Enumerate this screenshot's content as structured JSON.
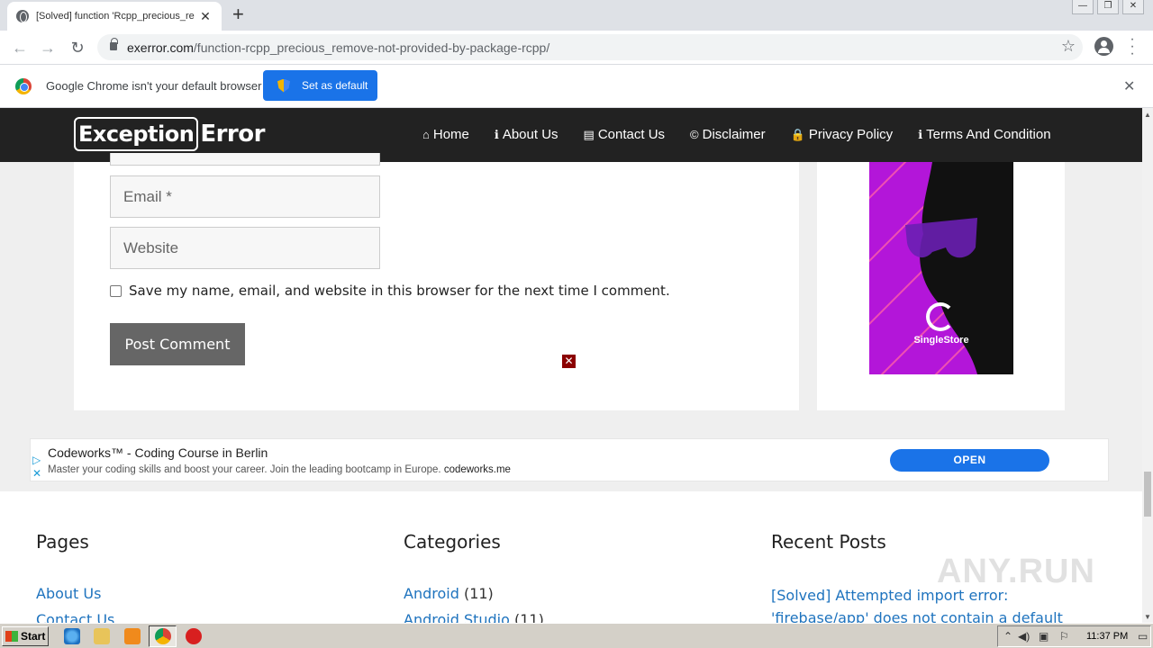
{
  "browser": {
    "tab_title": "[Solved] function 'Rcpp_precious_re",
    "tab_close": "✕",
    "new_tab": "+",
    "url_host": "exerror.com",
    "url_path": "/function-rcpp_precious_remove-not-provided-by-package-rcpp/",
    "window_controls": [
      "—",
      "❐",
      "✕"
    ]
  },
  "infobar": {
    "message": "Google Chrome isn't your default browser",
    "button": "Set as default",
    "close": "✕"
  },
  "site": {
    "logo_boxed": "Exception",
    "logo_rest": "Error",
    "nav": [
      {
        "icon": "home-icon",
        "glyph": "⌂",
        "label": "Home"
      },
      {
        "icon": "info-icon",
        "glyph": "ℹ",
        "label": "About Us"
      },
      {
        "icon": "contact-card-icon",
        "glyph": "▤",
        "label": "Contact Us"
      },
      {
        "icon": "copyright-icon",
        "glyph": "©",
        "label": "Disclaimer"
      },
      {
        "icon": "lock-icon",
        "glyph": "🔒",
        "label": "Privacy Policy"
      },
      {
        "icon": "info-circle-icon",
        "glyph": "ℹ",
        "label": "Terms And Condition"
      }
    ]
  },
  "form": {
    "email_placeholder": "Email *",
    "website_placeholder": "Website",
    "save_info_label": "Save my name, email, and website in this browser for the next time I comment.",
    "post_button": "Post Comment",
    "ad_close": "✕"
  },
  "sidebar_ad": {
    "brand": "SingleStore"
  },
  "banner_ad": {
    "title": "Codeworks™ - Coding Course in Berlin",
    "description": "Master your coding skills and boost your career. Join the leading bootcamp in Europe.",
    "domain": "codeworks.me",
    "button": "OPEN"
  },
  "footer": {
    "pages_heading": "Pages",
    "pages": [
      "About Us",
      "Contact Us"
    ],
    "categories_heading": "Categories",
    "categories": [
      {
        "name": "Android",
        "count": "(11)"
      },
      {
        "name": "Android Studio",
        "count": "(11)"
      }
    ],
    "recent_heading": "Recent Posts",
    "recent_post": "[Solved] Attempted import error: 'firebase/app' does not contain a default export (imported as"
  },
  "watermark": "ANY.RUN",
  "taskbar": {
    "start": "Start",
    "clock": "11:37 PM"
  }
}
